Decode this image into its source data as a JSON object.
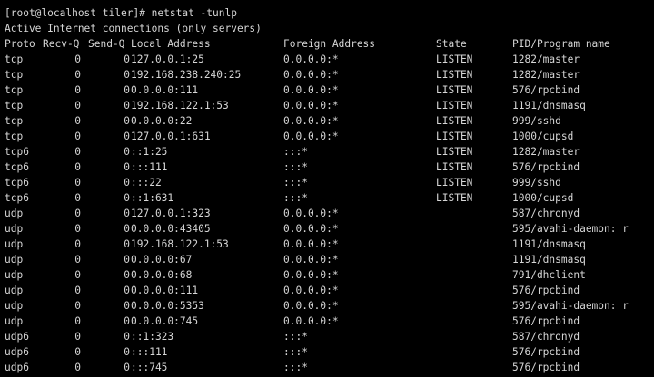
{
  "terminal": {
    "prompt_line": "[root@localhost tiler]# netstat -tunlp",
    "info_line": "Active Internet connections (only servers)",
    "headers": {
      "proto": "Proto",
      "recvq": "Recv-Q",
      "sendq": "Send-Q",
      "local": "Local Address",
      "foreign": "Foreign Address",
      "state": "State",
      "pid": "PID/Program name"
    },
    "rows": [
      {
        "proto": "tcp",
        "recvq": "0",
        "sendq": "0",
        "local": "127.0.0.1:25",
        "foreign": "0.0.0.0:*",
        "state": "LISTEN",
        "pid": "1282/master"
      },
      {
        "proto": "tcp",
        "recvq": "0",
        "sendq": "0",
        "local": "192.168.238.240:25",
        "foreign": "0.0.0.0:*",
        "state": "LISTEN",
        "pid": "1282/master"
      },
      {
        "proto": "tcp",
        "recvq": "0",
        "sendq": "0",
        "local": "0.0.0.0:111",
        "foreign": "0.0.0.0:*",
        "state": "LISTEN",
        "pid": "576/rpcbind"
      },
      {
        "proto": "tcp",
        "recvq": "0",
        "sendq": "0",
        "local": "192.168.122.1:53",
        "foreign": "0.0.0.0:*",
        "state": "LISTEN",
        "pid": "1191/dnsmasq"
      },
      {
        "proto": "tcp",
        "recvq": "0",
        "sendq": "0",
        "local": "0.0.0.0:22",
        "foreign": "0.0.0.0:*",
        "state": "LISTEN",
        "pid": "999/sshd"
      },
      {
        "proto": "tcp",
        "recvq": "0",
        "sendq": "0",
        "local": "127.0.0.1:631",
        "foreign": "0.0.0.0:*",
        "state": "LISTEN",
        "pid": "1000/cupsd"
      },
      {
        "proto": "tcp6",
        "recvq": "0",
        "sendq": "0",
        "local": "::1:25",
        "foreign": ":::*",
        "state": "LISTEN",
        "pid": "1282/master"
      },
      {
        "proto": "tcp6",
        "recvq": "0",
        "sendq": "0",
        "local": ":::111",
        "foreign": ":::*",
        "state": "LISTEN",
        "pid": "576/rpcbind"
      },
      {
        "proto": "tcp6",
        "recvq": "0",
        "sendq": "0",
        "local": ":::22",
        "foreign": ":::*",
        "state": "LISTEN",
        "pid": "999/sshd"
      },
      {
        "proto": "tcp6",
        "recvq": "0",
        "sendq": "0",
        "local": "::1:631",
        "foreign": ":::*",
        "state": "LISTEN",
        "pid": "1000/cupsd"
      },
      {
        "proto": "udp",
        "recvq": "0",
        "sendq": "0",
        "local": "127.0.0.1:323",
        "foreign": "0.0.0.0:*",
        "state": "",
        "pid": "587/chronyd"
      },
      {
        "proto": "udp",
        "recvq": "0",
        "sendq": "0",
        "local": "0.0.0.0:43405",
        "foreign": "0.0.0.0:*",
        "state": "",
        "pid": "595/avahi-daemon: r"
      },
      {
        "proto": "udp",
        "recvq": "0",
        "sendq": "0",
        "local": "192.168.122.1:53",
        "foreign": "0.0.0.0:*",
        "state": "",
        "pid": "1191/dnsmasq"
      },
      {
        "proto": "udp",
        "recvq": "0",
        "sendq": "0",
        "local": "0.0.0.0:67",
        "foreign": "0.0.0.0:*",
        "state": "",
        "pid": "1191/dnsmasq"
      },
      {
        "proto": "udp",
        "recvq": "0",
        "sendq": "0",
        "local": "0.0.0.0:68",
        "foreign": "0.0.0.0:*",
        "state": "",
        "pid": "791/dhclient"
      },
      {
        "proto": "udp",
        "recvq": "0",
        "sendq": "0",
        "local": "0.0.0.0:111",
        "foreign": "0.0.0.0:*",
        "state": "",
        "pid": "576/rpcbind"
      },
      {
        "proto": "udp",
        "recvq": "0",
        "sendq": "0",
        "local": "0.0.0.0:5353",
        "foreign": "0.0.0.0:*",
        "state": "",
        "pid": "595/avahi-daemon: r"
      },
      {
        "proto": "udp",
        "recvq": "0",
        "sendq": "0",
        "local": "0.0.0.0:745",
        "foreign": "0.0.0.0:*",
        "state": "",
        "pid": "576/rpcbind"
      },
      {
        "proto": "udp6",
        "recvq": "0",
        "sendq": "0",
        "local": "::1:323",
        "foreign": ":::*",
        "state": "",
        "pid": "587/chronyd"
      },
      {
        "proto": "udp6",
        "recvq": "0",
        "sendq": "0",
        "local": ":::111",
        "foreign": ":::*",
        "state": "",
        "pid": "576/rpcbind"
      },
      {
        "proto": "udp6",
        "recvq": "0",
        "sendq": "0",
        "local": ":::745",
        "foreign": ":::*",
        "state": "",
        "pid": "576/rpcbind"
      }
    ]
  },
  "colors": {
    "background": "#000000",
    "foreground": "#d6d6d6"
  }
}
